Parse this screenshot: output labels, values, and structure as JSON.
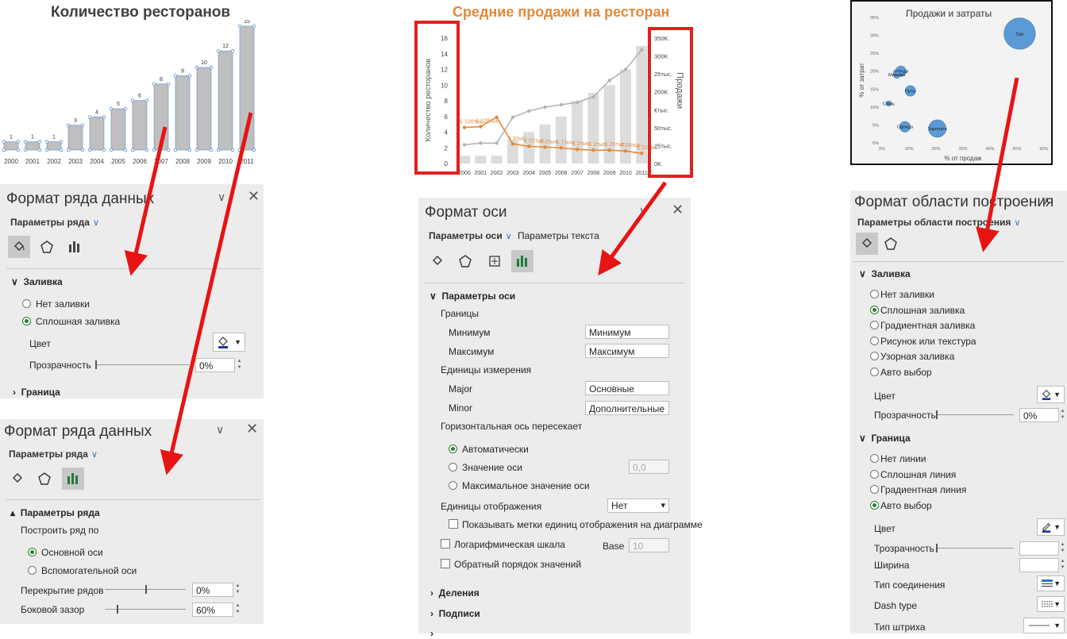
{
  "chart1": {
    "title": "Количество ресторанов",
    "chart_data": {
      "type": "bar",
      "categories": [
        "2000",
        "2001",
        "2002",
        "2003",
        "2004",
        "2005",
        "2006",
        "2007",
        "2008",
        "2009",
        "2010",
        "2011"
      ],
      "tick_labels": [
        "2000",
        "2001",
        "2002",
        "2003",
        "2004",
        "2005",
        "2006",
        "2007",
        "2008",
        "2009",
        "2010",
        "2011"
      ],
      "values": [
        1,
        1,
        1,
        3,
        4,
        5,
        6,
        8,
        9,
        10,
        12,
        15
      ],
      "ylim": [
        0,
        15
      ],
      "bar_color": "#bfbfbf",
      "selected": true
    }
  },
  "chart2": {
    "title": "Средние продажи на ресторан",
    "chart_data": {
      "type": "bar",
      "categories": [
        "2000",
        "2001",
        "2002",
        "2003",
        "2004",
        "2005",
        "2006",
        "2007",
        "2008",
        "2009",
        "2010",
        "2011"
      ],
      "tick_labels": [
        "2000",
        "2001",
        "2002",
        "2003",
        "2004",
        "2005",
        "2006",
        "2007",
        "2008",
        "2009",
        "2010",
        "2011"
      ],
      "series": [
        {
          "values": [
            1,
            1,
            1,
            3,
            4,
            5,
            6,
            8,
            9,
            10,
            12,
            15
          ],
          "color": "#dcdcdc"
        },
        {
          "values": [
            4.6,
            4.7,
            5.9,
            2.5,
            2.2,
            2.1,
            2.0,
            1.8,
            1.7,
            1.7,
            1.6,
            1.3
          ],
          "color": "#e28a3a"
        },
        {
          "values": [
            2.4,
            2.6,
            2.6,
            5.9,
            6.7,
            7.2,
            7.5,
            7.8,
            8.5,
            10.6,
            12.0,
            14.5
          ],
          "color": "#b3b3b3"
        }
      ],
      "ylim": [
        0,
        16
      ],
      "left_ticks": [
        "0",
        "2",
        "4",
        "6",
        "8",
        "10",
        "12",
        "14",
        "16"
      ],
      "right_ticks": [
        "0K",
        "25тыс.",
        "50тыс.",
        "€тыс.",
        "200K",
        "25тыс.",
        "300K",
        "350K."
      ],
      "ylabel": "Количество ресторанов",
      "y2label": "Продажи",
      "point_labels": [
        "€ 100тыс.",
        "€ 128тыс.",
        "€ 3тыс.",
        "€ 01тыс.",
        "€ 2тыс.",
        "€ 1тыс.",
        "€ 2тыс.",
        "€ 2тыс.",
        "€ 25тыс.",
        "€ 20тыс.",
        "€ 22тыс."
      ],
      "highlight_color": "#e02020"
    }
  },
  "chart3": {
    "title": "Продажи и затраты",
    "chart_data": {
      "type": "scatter",
      "xlabel": "% от продаж",
      "ylabel": "% от затрат",
      "x_ticks": [
        "0%",
        "10%",
        "20%",
        "30%",
        "40%",
        "50%",
        "60%"
      ],
      "y_ticks": [
        "0%",
        "5%",
        "10%",
        "15%",
        "20%",
        "25%",
        "30%",
        "35%"
      ],
      "xlim": [
        0,
        0.6
      ],
      "ylim": [
        0,
        0.35
      ],
      "points": [
        {
          "label": "Еда",
          "x": 0.51,
          "y": 0.305,
          "r": 9
        },
        {
          "label": "Аренда",
          "x": 0.07,
          "y": 0.2,
          "r": 3
        },
        {
          "label": "Мимемс",
          "x": 0.055,
          "y": 0.19,
          "r": 2
        },
        {
          "label": "Путы",
          "x": 0.105,
          "y": 0.145,
          "r": 3
        },
        {
          "label": "Связь",
          "x": 0.025,
          "y": 0.11,
          "r": 1.5
        },
        {
          "label": "Одежда",
          "x": 0.085,
          "y": 0.045,
          "r": 3
        },
        {
          "label": "Зарплата",
          "x": 0.205,
          "y": 0.04,
          "r": 5
        }
      ],
      "point_color": "#5b9bd5"
    }
  },
  "panel1": {
    "title": "Формат ряда данных",
    "subtitle": "Параметры ряда",
    "section_fill": "Заливка",
    "radio_no_fill": "Нет заливки",
    "radio_solid": "Сплошная заливка",
    "color_label": "Цвет",
    "transparency_label": "Прозрачность",
    "transparency_value": "0%",
    "section_border": "Граница"
  },
  "panel2": {
    "title": "Формат ряда данных",
    "subtitle": "Параметры ряда",
    "section": "Параметры ряда",
    "plot_on": "Построить ряд по",
    "radio_primary": "Основной оси",
    "radio_secondary": "Вспомогательной оси",
    "overlap_label": "Перекрытие рядов",
    "overlap_value": "0%",
    "gap_label": "Боковой зазор",
    "gap_value": "60%",
    "gap_level": 0.6
  },
  "panel3": {
    "title": "Формат оси",
    "tab1": "Параметры оси",
    "tab2": "Параметры текста",
    "section": "Параметры оси",
    "bounds": "Границы",
    "min_label": "Минимум",
    "min_value": "Минимум",
    "max_label": "Максимум",
    "max_value": "Максимум",
    "units": "Единицы измерения",
    "major_label": "Major",
    "major_value": "Основные",
    "minor_label": "Minor",
    "minor_value": "Дополнительные",
    "crosses": "Горизонтальная ось пересекает",
    "radio_auto": "Автоматически",
    "radio_value": "Значение оси",
    "value_field": "0,0",
    "radio_max": "Максимальное значение оси",
    "display_units": "Единицы отображения",
    "display_units_value": "Нет",
    "show_units_label": "Показывать метки единиц отображения на диаграмме",
    "log_scale": "Логарифмическая шкала",
    "base_label": "Base",
    "base_value": "10",
    "reverse": "Обратный порядок значений",
    "tick_marks": "Деления",
    "labels": "Подписи"
  },
  "panel4": {
    "title": "Формат области построения",
    "subtitle": "Параметры области построения",
    "section_fill": "Заливка",
    "fill_options": [
      "Нет заливки",
      "Сплошная заливка",
      "Градиентная заливка",
      "Рисунок или текстура",
      "Узорная заливка",
      "Авто выбор"
    ],
    "fill_selected": 1,
    "color_label": "Цвет",
    "transparency_label": "Прозрачность",
    "transparency_value": "0%",
    "section_border": "Граница",
    "border_options": [
      "Нет линии",
      "Сплошная линия",
      "Градиентная линия",
      "Авто выбор"
    ],
    "border_selected": 3,
    "b_color_label": "Цвет",
    "b_transparency_label": "Трозрачность",
    "b_width_label": "Ширина",
    "join_label": "Тип соединения",
    "dash_label": "Dash type",
    "cap_label": "Тип штриха"
  },
  "arrows_color": "#e81414"
}
